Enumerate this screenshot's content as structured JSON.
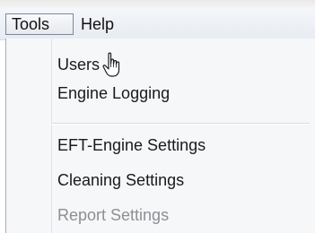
{
  "top_strip_text": "                  ",
  "menubar": {
    "tools_label": "Tools",
    "help_label": "Help"
  },
  "dropdown": {
    "items": [
      {
        "label": "Users",
        "enabled": true
      },
      {
        "label": "Engine Logging",
        "enabled": true
      },
      {
        "label": "EFT-Engine Settings",
        "enabled": true
      },
      {
        "label": "Cleaning Settings",
        "enabled": true
      },
      {
        "label": "Report Settings",
        "enabled": false
      }
    ]
  },
  "cursor": {
    "icon": "hand-pointer-icon"
  },
  "colors": {
    "menubar_bg": "#eef1f6",
    "dropdown_bg": "#f6f7f8",
    "disabled_text": "#8c8f94"
  }
}
